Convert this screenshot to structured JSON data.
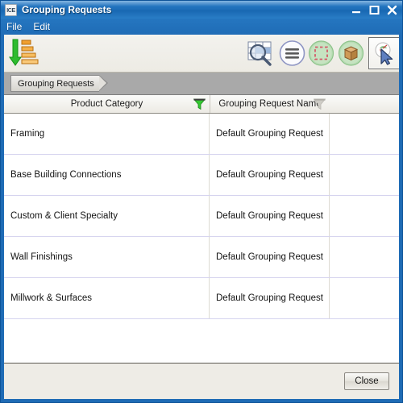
{
  "window": {
    "app_icon_label": "ICE",
    "title": "Grouping Requests",
    "controls": {
      "minimize": "minimize-icon",
      "maximize": "maximize-icon",
      "close": "close-icon"
    }
  },
  "menubar": {
    "items": [
      {
        "label": "File"
      },
      {
        "label": "Edit"
      }
    ]
  },
  "toolbar": {
    "items": [
      {
        "name": "sort-descending-icon",
        "tooltip": "Sort"
      },
      {
        "name": "zoom-table-icon",
        "tooltip": "Zoom Table"
      },
      {
        "name": "list-menu-icon",
        "tooltip": "Menu"
      },
      {
        "name": "selection-box-icon",
        "tooltip": "Select"
      },
      {
        "name": "model-box-icon",
        "tooltip": "Model"
      },
      {
        "name": "pick-cursor-icon",
        "tooltip": "Pick"
      }
    ]
  },
  "breadcrumb": {
    "label": "Grouping Requests"
  },
  "grid": {
    "columns": [
      {
        "label": "Product Category",
        "filter": "active"
      },
      {
        "label": "Grouping Request Name",
        "filter": "inactive"
      }
    ],
    "rows": [
      {
        "category": "Framing",
        "request": "Default Grouping Request"
      },
      {
        "category": "Base Building Connections",
        "request": "Default Grouping Request"
      },
      {
        "category": "Custom & Client Specialty",
        "request": "Default Grouping Request"
      },
      {
        "category": "Wall Finishings",
        "request": "Default Grouping Request"
      },
      {
        "category": "Millwork & Surfaces",
        "request": "Default Grouping Request"
      }
    ]
  },
  "footer": {
    "close_label": "Close"
  },
  "colors": {
    "titlebar_blue": "#1f6bb5",
    "filter_active_green": "#35c832",
    "filter_inactive_gray": "#cfcdc7",
    "sort_arrow_green": "#29a329",
    "sort_bars_orange": "#f0a030",
    "panel_beige": "#eeece6",
    "tabstrip_gray": "#a9a9a9"
  }
}
